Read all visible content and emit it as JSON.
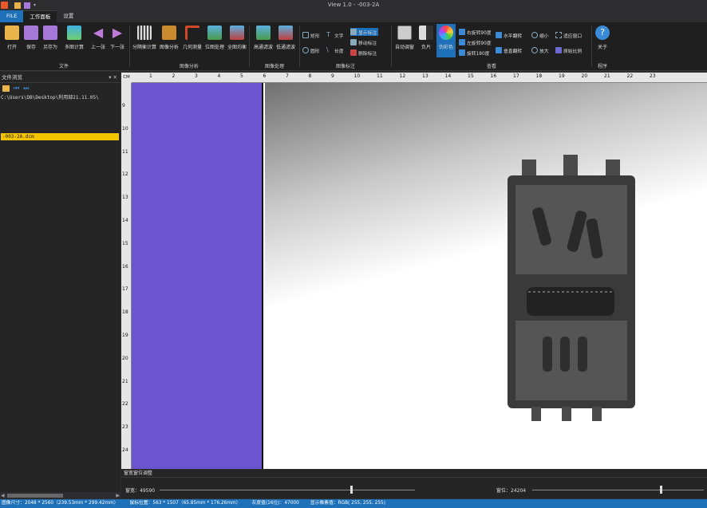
{
  "app": {
    "title": "View 1.0 - -003-2A"
  },
  "tabs": [
    {
      "label": "FILE"
    },
    {
      "label": "工作面板"
    },
    {
      "label": "设置"
    }
  ],
  "ribbon": {
    "groups": [
      {
        "label": "文件",
        "buttons": [
          "打开",
          "保存",
          "另存为",
          "多图计算",
          "上一张",
          "下一张"
        ]
      },
      {
        "label": "图像分析",
        "buttons": [
          "分隔衡计算",
          "图像分析",
          "几何测量",
          "位图处理",
          "全图均衡"
        ]
      },
      {
        "label": "图像处理",
        "buttons": [
          "高通滤波",
          "低通滤波"
        ]
      },
      {
        "label": "图像标注",
        "buttons": [
          "矩形",
          "圆形",
          "文字",
          "长度",
          "显示标注",
          "移动标注",
          "删除标注"
        ]
      },
      {
        "label": "查看",
        "buttons": [
          "自动调窗",
          "负片",
          "伪彩色",
          "右旋转90度",
          "左旋转90度",
          "旋转180度",
          "水平翻转",
          "垂直翻转",
          "缩小",
          "放大",
          "适应窗口",
          "原始比例"
        ]
      },
      {
        "label": "程序",
        "buttons": [
          "关于"
        ]
      }
    ]
  },
  "file_panel": {
    "title": "文件浏览",
    "path": "C:\\Users\\DB\\Desktop\\利用部21.11.05\\",
    "files": [
      "-003-2A.dcm"
    ]
  },
  "ruler": {
    "corner": "CM",
    "top_labels": [
      "1",
      "2",
      "3",
      "4",
      "5",
      "6",
      "7",
      "8",
      "9",
      "10",
      "11",
      "12",
      "13",
      "14",
      "15",
      "16",
      "17",
      "18",
      "19",
      "20",
      "21",
      "22",
      "23"
    ],
    "left_labels": [
      "9",
      "10",
      "11",
      "12",
      "13",
      "14",
      "15",
      "16",
      "17",
      "18",
      "19",
      "20",
      "21",
      "22",
      "23",
      "24"
    ]
  },
  "window_level": {
    "title": "窗宽窗位调整",
    "width_label": "窗宽：49590",
    "level_label": "窗位：24204",
    "width_position": 0.75,
    "level_position": 0.75
  },
  "status": {
    "image_size": "图像尺寸：2048 * 2560（239.53mm * 299.42mm）",
    "mouse_pos": "鼠标位置：563 * 1507（65.85mm * 176.26mm）",
    "gray_value": "灰度值(16位)：47000",
    "display_pixel": "显示像素值：RGB( 255, 255, 255)"
  },
  "colors": {
    "accent": "#1e70b8",
    "highlight": "#f5c400",
    "purple": "#6a55cf"
  }
}
